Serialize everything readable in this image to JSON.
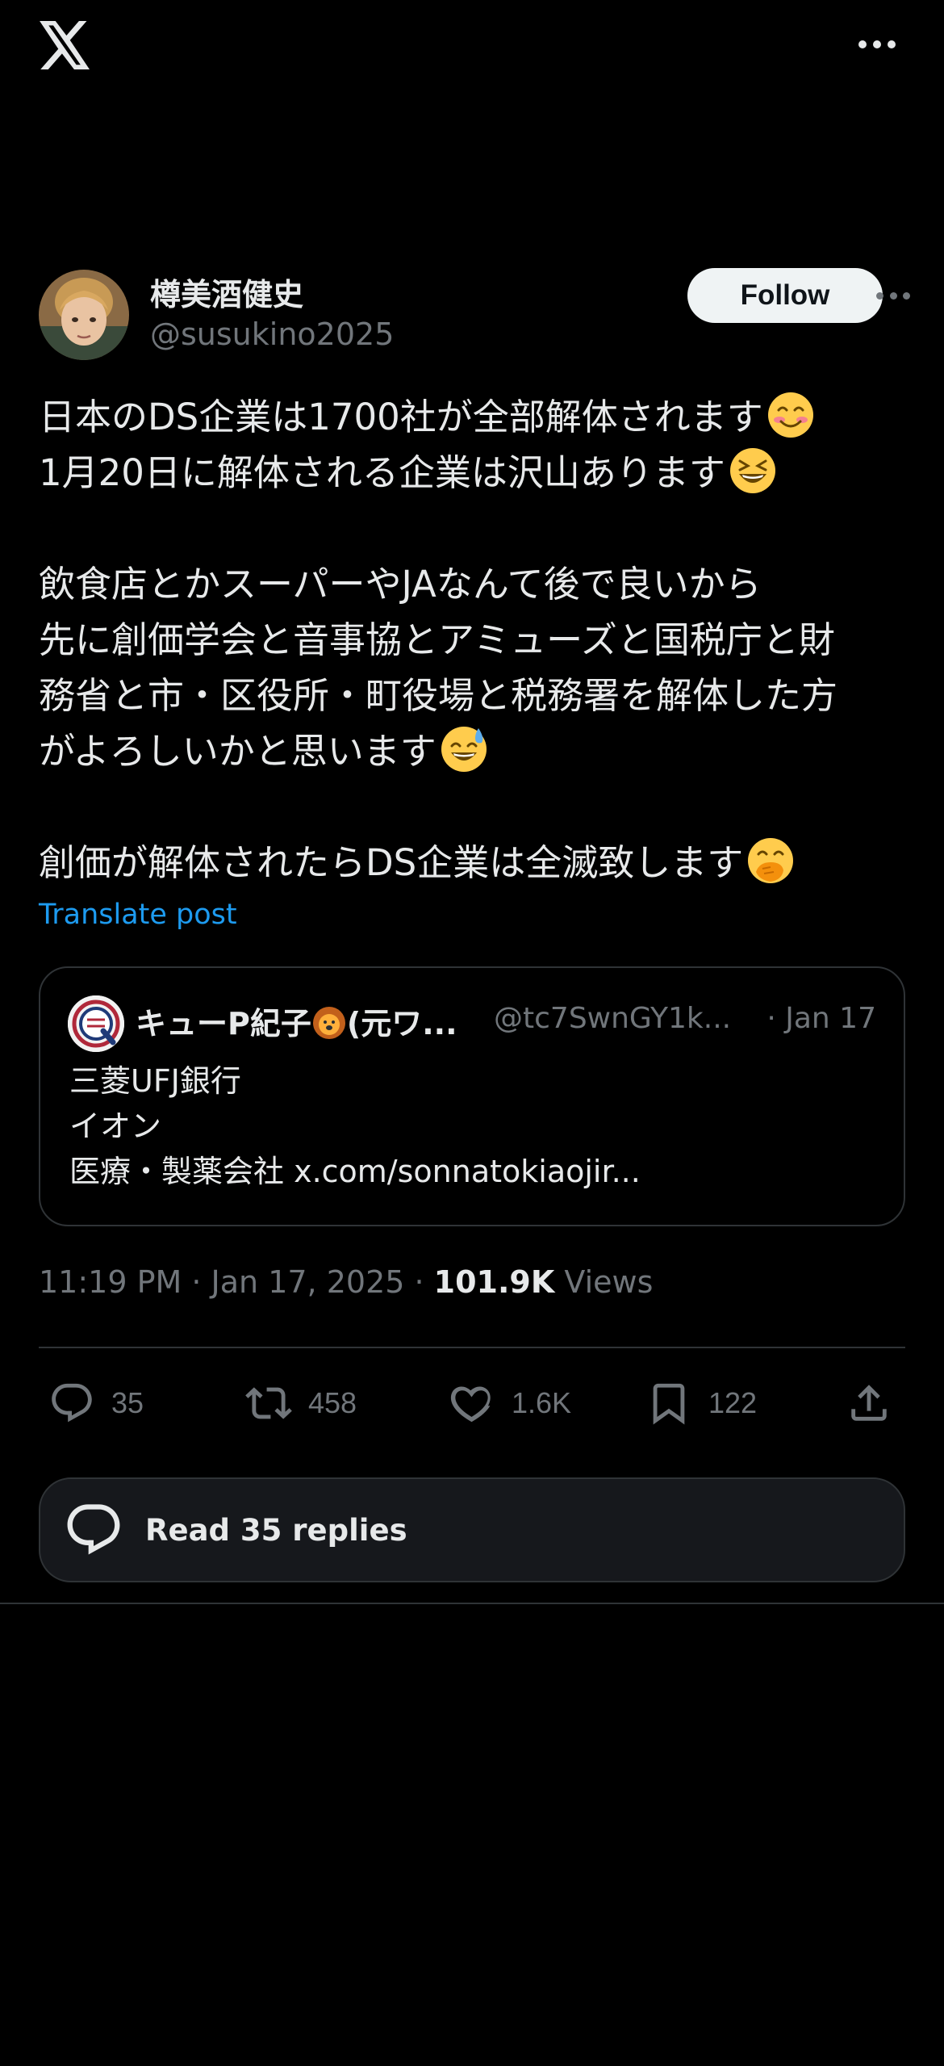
{
  "app": {
    "name": "X",
    "accent": "#1d9bf0",
    "background": "#000000"
  },
  "topbar": {
    "logo_icon": "x-logo-icon",
    "more_icon": "more-horizontal-icon"
  },
  "author": {
    "display_name": "樽美酒健史",
    "handle": "@susukino2025",
    "follow_label": "Follow"
  },
  "post": {
    "lines": [
      "日本のDS企業は1700社が全部解体されます",
      "1月20日に解体される企業は沢山あります",
      "",
      "飲食店とかスーパーやJAなんて後で良いから",
      "先に創価学会と音事協とアミューズと国税庁と財",
      "務省と市・区役所・町役場と税務署を解体した方",
      "がよろしいかと思います",
      "",
      "創価が解体されたらDS企業は全滅致します"
    ],
    "emojis": [
      "smiling-face-icon",
      "grinning-squinting-face-icon",
      "grinning-sweat-face-icon",
      "face-with-hand-over-mouth-icon"
    ],
    "translate_label": "Translate post"
  },
  "quote": {
    "name": "キューP紀子",
    "name_suffix": "(元ワ...",
    "handle": "@tc7SwnGY1k...",
    "date": "· Jan 17",
    "lines": [
      "三菱UFJ銀行",
      "イオン",
      "医療・製薬会社 x.com/sonnatokiaojir..."
    ]
  },
  "meta": {
    "time": "11:19 PM",
    "date": "Jan 17, 2025",
    "separator": " · ",
    "views_count": "101.9K",
    "views_label": "Views"
  },
  "actions": {
    "replies": "35",
    "reposts": "458",
    "likes": "1.6K",
    "bookmarks": "122"
  },
  "read_replies": {
    "label": "Read 35 replies"
  }
}
